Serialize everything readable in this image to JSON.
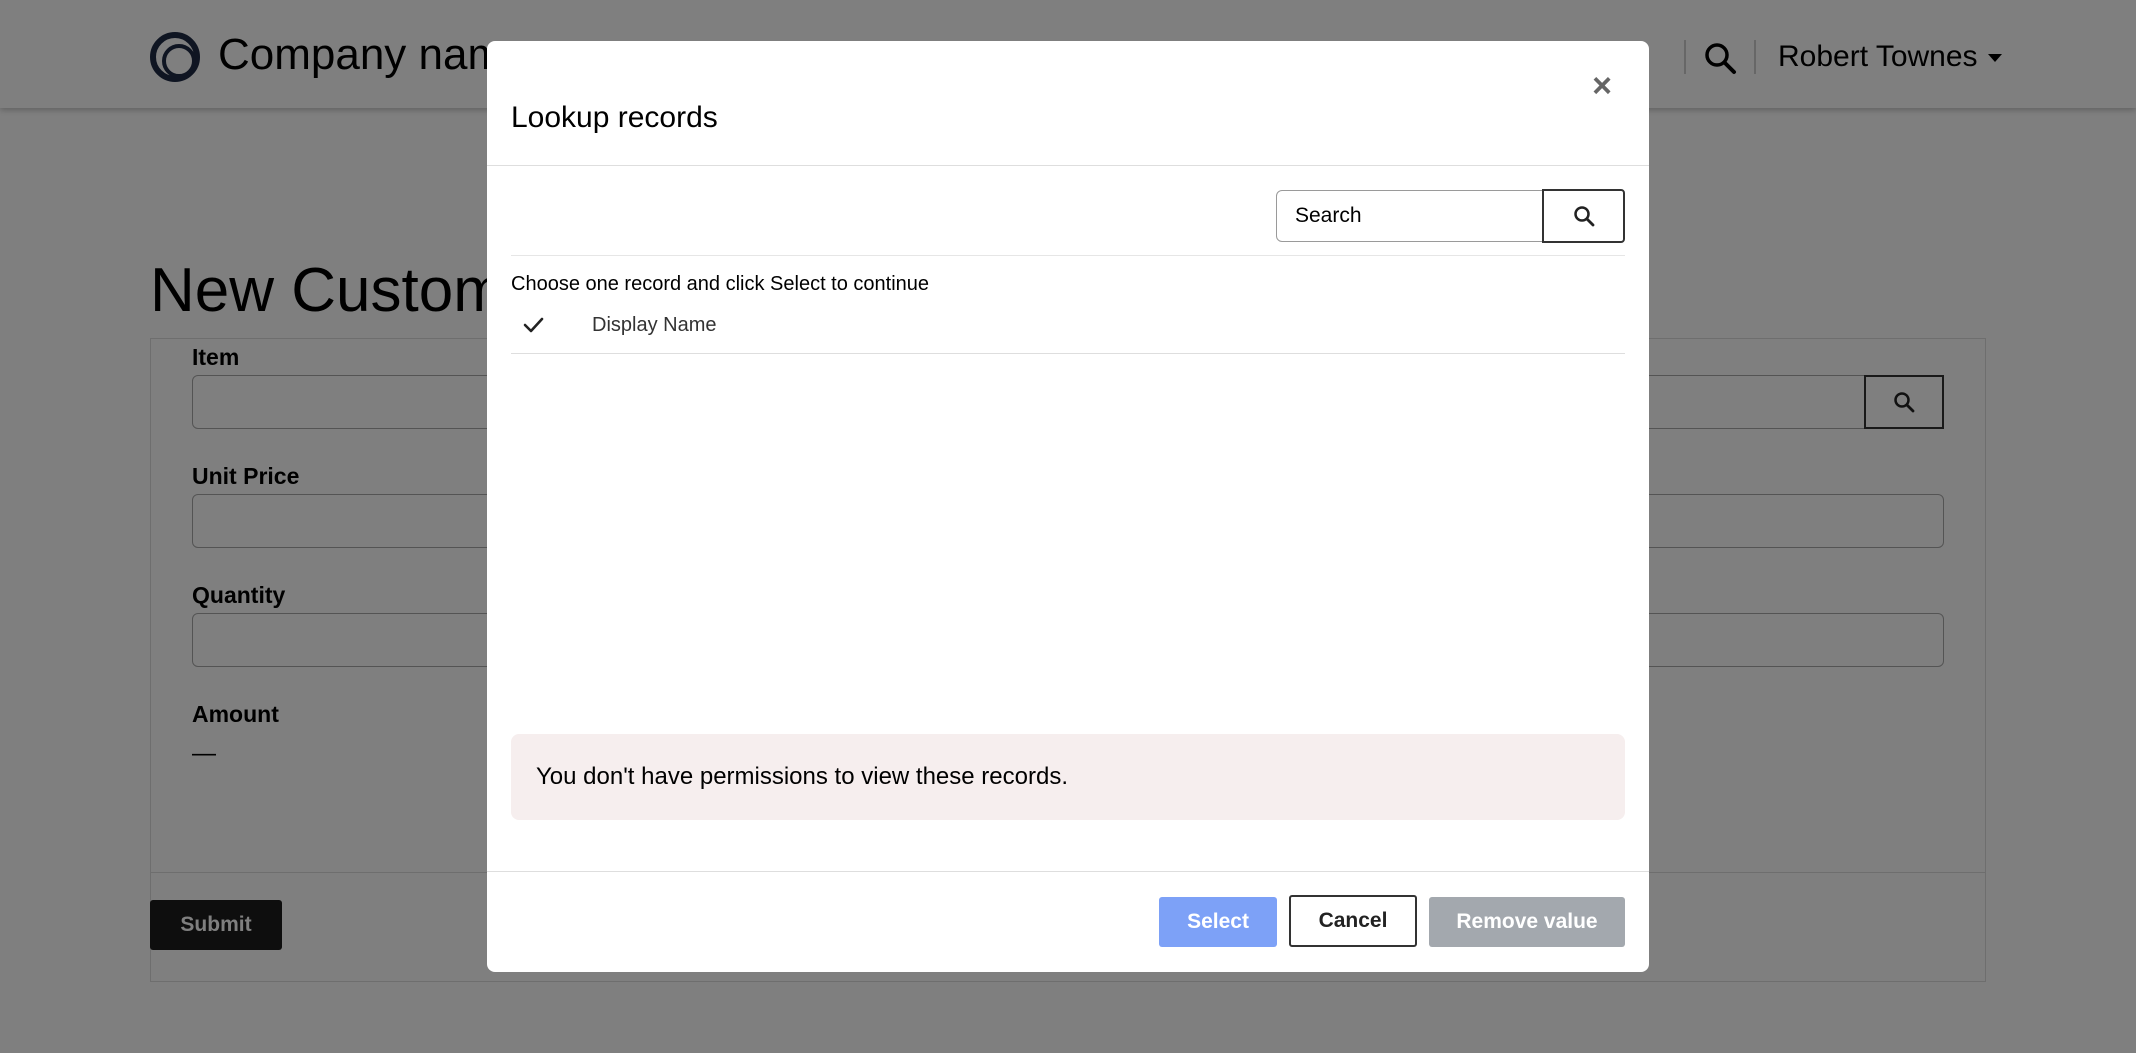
{
  "header": {
    "company_name": "Company name",
    "nav_partial": "s",
    "user_name": "Robert Townes"
  },
  "page": {
    "title": "New Customer",
    "fields": {
      "item_label": "Item",
      "unit_price_label": "Unit Price",
      "quantity_label": "Quantity",
      "amount_label": "Amount",
      "amount_value": "—"
    },
    "submit_label": "Submit"
  },
  "modal": {
    "title": "Lookup records",
    "close_glyph": "×",
    "search_placeholder": "Search",
    "instruction": "Choose one record and click Select to continue",
    "column_header": "Display Name",
    "permission_message": "You don't have permissions to view these records.",
    "select_label": "Select",
    "cancel_label": "Cancel",
    "remove_label": "Remove value"
  },
  "colors": {
    "select_button": "#7da1f7",
    "remove_button": "#a3a8ae",
    "permission_bg": "#f6eeee",
    "overlay": "rgba(0,0,0,0.5)"
  },
  "icons": [
    "logo-icon",
    "search-icon",
    "caret-down-icon",
    "close-icon",
    "checkmark-icon"
  ]
}
